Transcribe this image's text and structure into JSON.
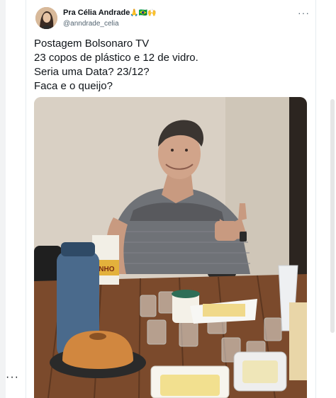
{
  "author": {
    "display_name": "Pra Célia Andrade",
    "emojis": "🙏🇧🇷🙌",
    "handle": "@anndrade_celia"
  },
  "tweet": {
    "lines": [
      "Postagem Bolsonaro TV",
      "23 copos de plástico e 12 de vidro.",
      "Seria uma Data? 23/12?",
      "Faca e o queijo?"
    ]
  },
  "menu": {
    "more_glyph": "···",
    "side_glyph": "···"
  },
  "photo": {
    "carton_label": "INHO"
  },
  "colors": {
    "text": "#0f1419",
    "secondary": "#536471",
    "border": "#e6ecf0"
  }
}
